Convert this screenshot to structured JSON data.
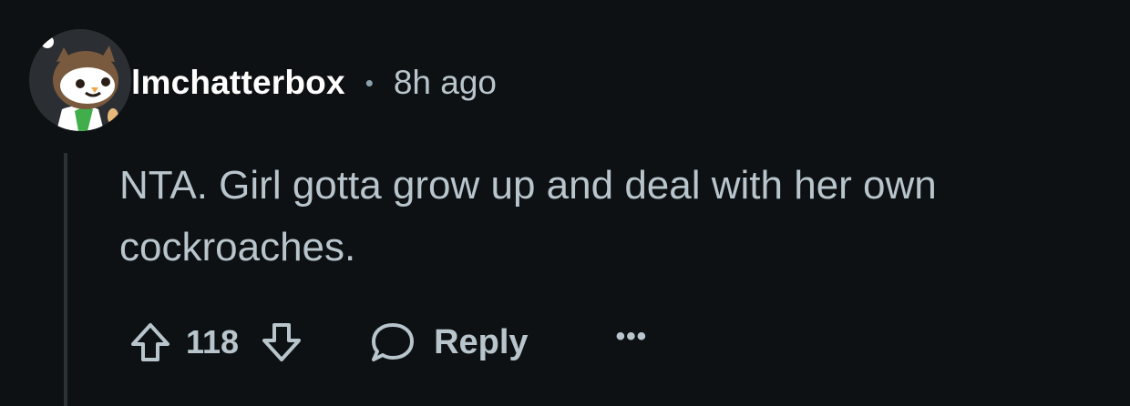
{
  "comment": {
    "username": "lmchatterbox",
    "separator": "•",
    "timestamp": "8h ago",
    "body": "NTA. Girl gotta grow up and deal with her own cockroaches.",
    "avatar_icon": "owl-avatar-icon"
  },
  "actions": {
    "upvote_icon": "arrow-up-icon",
    "vote_count": "118",
    "downvote_icon": "arrow-down-icon",
    "reply_icon": "speech-bubble-icon",
    "reply_label": "Reply",
    "more_label": "•••"
  },
  "colors": {
    "background": "#0e1113",
    "text_primary": "#ffffff",
    "text_secondary": "#b8c5cc",
    "thread_line": "#2a3236"
  }
}
